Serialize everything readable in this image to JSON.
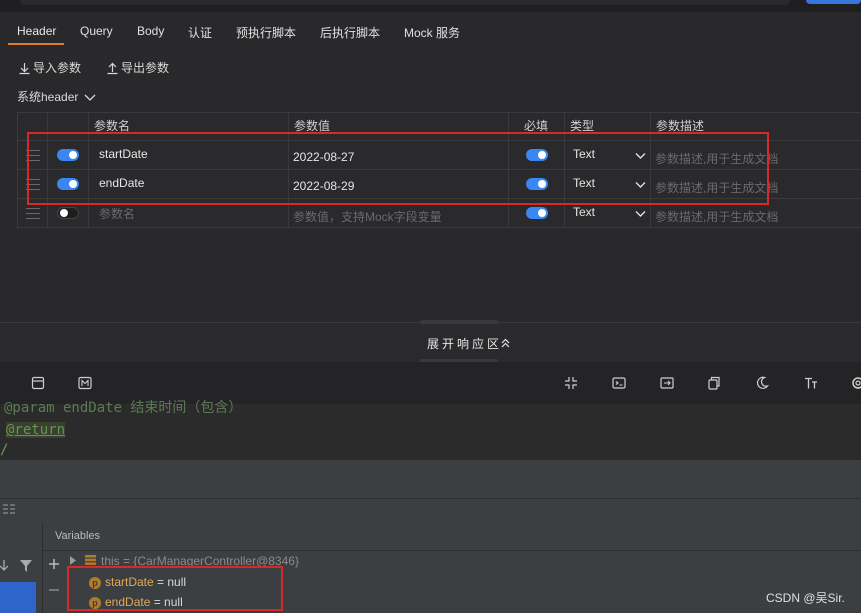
{
  "tabs": [
    "Header",
    "Query",
    "Body",
    "认证",
    "预执行脚本",
    "后执行脚本",
    "Mock 服务"
  ],
  "toolbar": {
    "import": "导入参数",
    "export": "导出参数"
  },
  "system_header": "系统header",
  "table": {
    "headers": {
      "name": "参数名",
      "value": "参数值",
      "required": "必填",
      "type": "类型",
      "desc": "参数描述"
    },
    "rows": [
      {
        "name": "startDate",
        "value": "2022-08-27",
        "type": "Text",
        "desc": "参数描述,用于生成文档"
      },
      {
        "name": "endDate",
        "value": "2022-08-29",
        "type": "Text",
        "desc": "参数描述,用于生成文档"
      },
      {
        "name": "参数名",
        "value": "参数值，支持Mock字段变量",
        "type": "Text",
        "desc": "参数描述,用于生成文档"
      }
    ]
  },
  "expand_label": "展开响应区",
  "code": {
    "line1": "@param endDate 结束时间（包含）",
    "line2": "@return",
    "line3": "/"
  },
  "debug": {
    "variables_title": "Variables",
    "this_line": "this = {CarManagerController@8346}",
    "vars": [
      {
        "badge": "p",
        "name": "startDate",
        "value": "= null"
      },
      {
        "badge": "p",
        "name": "endDate",
        "value": "= null"
      }
    ]
  },
  "watermark": "CSDN @吴Sir."
}
